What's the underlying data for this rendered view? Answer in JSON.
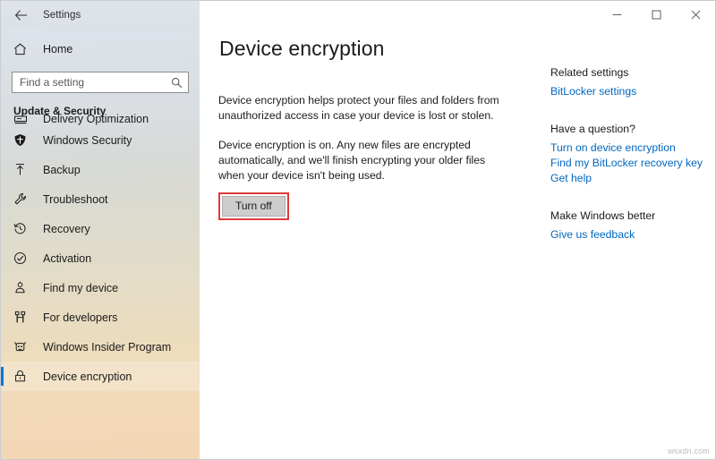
{
  "window": {
    "titlebar_title": "Settings",
    "back_icon": "back-arrow-icon",
    "minimize_label": "–",
    "maximize_label": "☐",
    "close_label": "✕"
  },
  "sidebar": {
    "home_label": "Home",
    "home_icon": "home-icon",
    "search": {
      "placeholder": "Find a setting",
      "value": "",
      "icon": "search-icon"
    },
    "group_title": "Update & Security",
    "items": [
      {
        "label": "Delivery Optimization",
        "icon": "delivery-optimization-icon",
        "selected": false,
        "clipped": true
      },
      {
        "label": "Windows Security",
        "icon": "shield-icon",
        "selected": false,
        "clipped": false
      },
      {
        "label": "Backup",
        "icon": "backup-upload-icon",
        "selected": false,
        "clipped": false
      },
      {
        "label": "Troubleshoot",
        "icon": "wrench-icon",
        "selected": false,
        "clipped": false
      },
      {
        "label": "Recovery",
        "icon": "history-clock-icon",
        "selected": false,
        "clipped": false
      },
      {
        "label": "Activation",
        "icon": "check-circle-icon",
        "selected": false,
        "clipped": false
      },
      {
        "label": "Find my device",
        "icon": "find-device-icon",
        "selected": false,
        "clipped": false
      },
      {
        "label": "For developers",
        "icon": "developer-tools-icon",
        "selected": false,
        "clipped": false
      },
      {
        "label": "Windows Insider Program",
        "icon": "insider-bug-icon",
        "selected": false,
        "clipped": false
      },
      {
        "label": "Device encryption",
        "icon": "lock-icon",
        "selected": true,
        "clipped": false
      }
    ],
    "accent_color": "#0078d4"
  },
  "main": {
    "page_title": "Device encryption",
    "paragraph_1": "Device encryption helps protect your files and folders from unauthorized access in case your device is lost or stolen.",
    "paragraph_2": "Device encryption is on. Any new files are encrypted automatically, and we'll finish encrypting your older files when your device isn't being used.",
    "turn_off_button": "Turn off",
    "annotation_color": "#e03a3a"
  },
  "rail": {
    "groups": [
      {
        "heading": "Related settings",
        "links": [
          "BitLocker settings"
        ]
      },
      {
        "heading": "Have a question?",
        "links": [
          "Turn on device encryption",
          "Find my BitLocker recovery key",
          "Get help"
        ]
      },
      {
        "heading": "Make Windows better",
        "links": [
          "Give us feedback"
        ]
      }
    ],
    "link_color": "#0067c0"
  },
  "watermark": "wsxdn.com"
}
